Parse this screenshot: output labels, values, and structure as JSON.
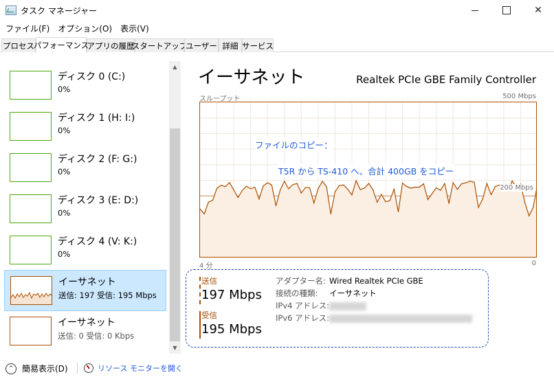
{
  "window": {
    "title": "タスク マネージャー"
  },
  "menu": [
    "ファイル(F)",
    "オプション(O)",
    "表示(V)"
  ],
  "tabs": [
    "プロセス",
    "パフォーマンス",
    "アプリの履歴",
    "スタートアップ",
    "ユーザー",
    "詳細",
    "サービス"
  ],
  "resources": [
    {
      "name": "ディスク 0 (C:)",
      "value": "0%"
    },
    {
      "name": "ディスク 1 (H: I:)",
      "value": "0%"
    },
    {
      "name": "ディスク 2 (F: G:)",
      "value": "0%"
    },
    {
      "name": "ディスク 3 (E: D:)",
      "value": "0%"
    },
    {
      "name": "ディスク 4 (V: K:)",
      "value": "0%"
    },
    {
      "name": "イーサネット",
      "value": "送信: 197 受信: 195 Mbps"
    },
    {
      "name": "イーサネット",
      "value": "送信: 0 受信: 0 Kbps"
    }
  ],
  "detail": {
    "heading": "イーサネット",
    "adapter": "Realtek PCIe GBE Family Controller",
    "throughput_label": "スループット",
    "ymax_label": "500 Mbps",
    "mid_label": "200 Mbps",
    "x_left": "4 分",
    "x_right": "0",
    "annotation_line1": "ファイルのコピー：",
    "annotation_line2": "T5R から TS-410 へ、合計 400GB をコピー"
  },
  "stats": {
    "send_label": "送信",
    "send_value": "197 Mbps",
    "recv_label": "受信",
    "recv_value": "195 Mbps"
  },
  "adapter_info": {
    "name_key": "アダプター名:",
    "name_value": "Wired Realtek PCIe GBE",
    "type_key": "接続の種類:",
    "type_value": "イーサネット",
    "ipv4_key": "IPv4 アドレス:",
    "ipv6_key": "IPv6 アドレス:"
  },
  "bottom": {
    "fewer_details": "簡易表示(D)",
    "open_monitor": "リソース モニターを開く"
  },
  "colors": {
    "accent_net": "#a74f01",
    "disk": "#4da60c",
    "link": "#1f5bd6",
    "selection": "#cce8ff"
  },
  "chart_data": {
    "type": "area",
    "ylim": [
      0,
      500
    ],
    "series": [
      {
        "values": [
          158,
          142,
          180,
          186,
          224,
          234,
          230,
          243,
          219,
          195,
          217,
          231,
          223,
          228,
          190,
          232,
          242,
          235,
          168,
          219,
          247,
          223,
          236,
          240,
          209,
          227,
          226,
          177,
          223,
          247,
          229,
          142,
          213,
          233,
          235,
          222,
          203,
          249,
          220,
          225,
          240,
          219,
          180,
          205,
          181,
          185,
          222,
          149,
          241,
          230,
          225,
          228,
          228,
          239,
          188,
          207,
          226,
          218,
          240,
          176,
          242,
          221,
          239,
          242,
          247,
          244,
          163,
          190,
          240,
          204,
          230,
          235,
          235,
          215,
          248,
          228,
          238,
          179,
          136,
          164,
          238
        ]
      }
    ]
  }
}
